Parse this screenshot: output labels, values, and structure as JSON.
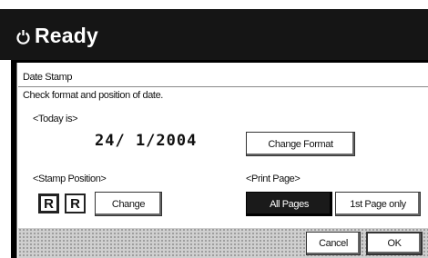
{
  "header": {
    "status_text": "Ready",
    "icon": "power-ring-icon"
  },
  "dialog": {
    "title": "Date Stamp",
    "instruction": "Check format and position of date.",
    "today_label": "<Today is>",
    "today_value": "24/ 1/2004",
    "change_format_label": "Change Format",
    "stamp_position_label": "<Stamp Position>",
    "position_options": [
      "R",
      "R"
    ],
    "change_label": "Change",
    "print_page_label": "<Print Page>",
    "print_page_options": [
      "All Pages",
      "1st Page only"
    ],
    "selected_print_page": "All Pages"
  },
  "footer": {
    "cancel_label": "Cancel",
    "ok_label": "OK"
  },
  "colors": {
    "header_bg": "#151515",
    "selected_bg": "#1a1a1a",
    "footer_bg": "#cfcfcf"
  }
}
